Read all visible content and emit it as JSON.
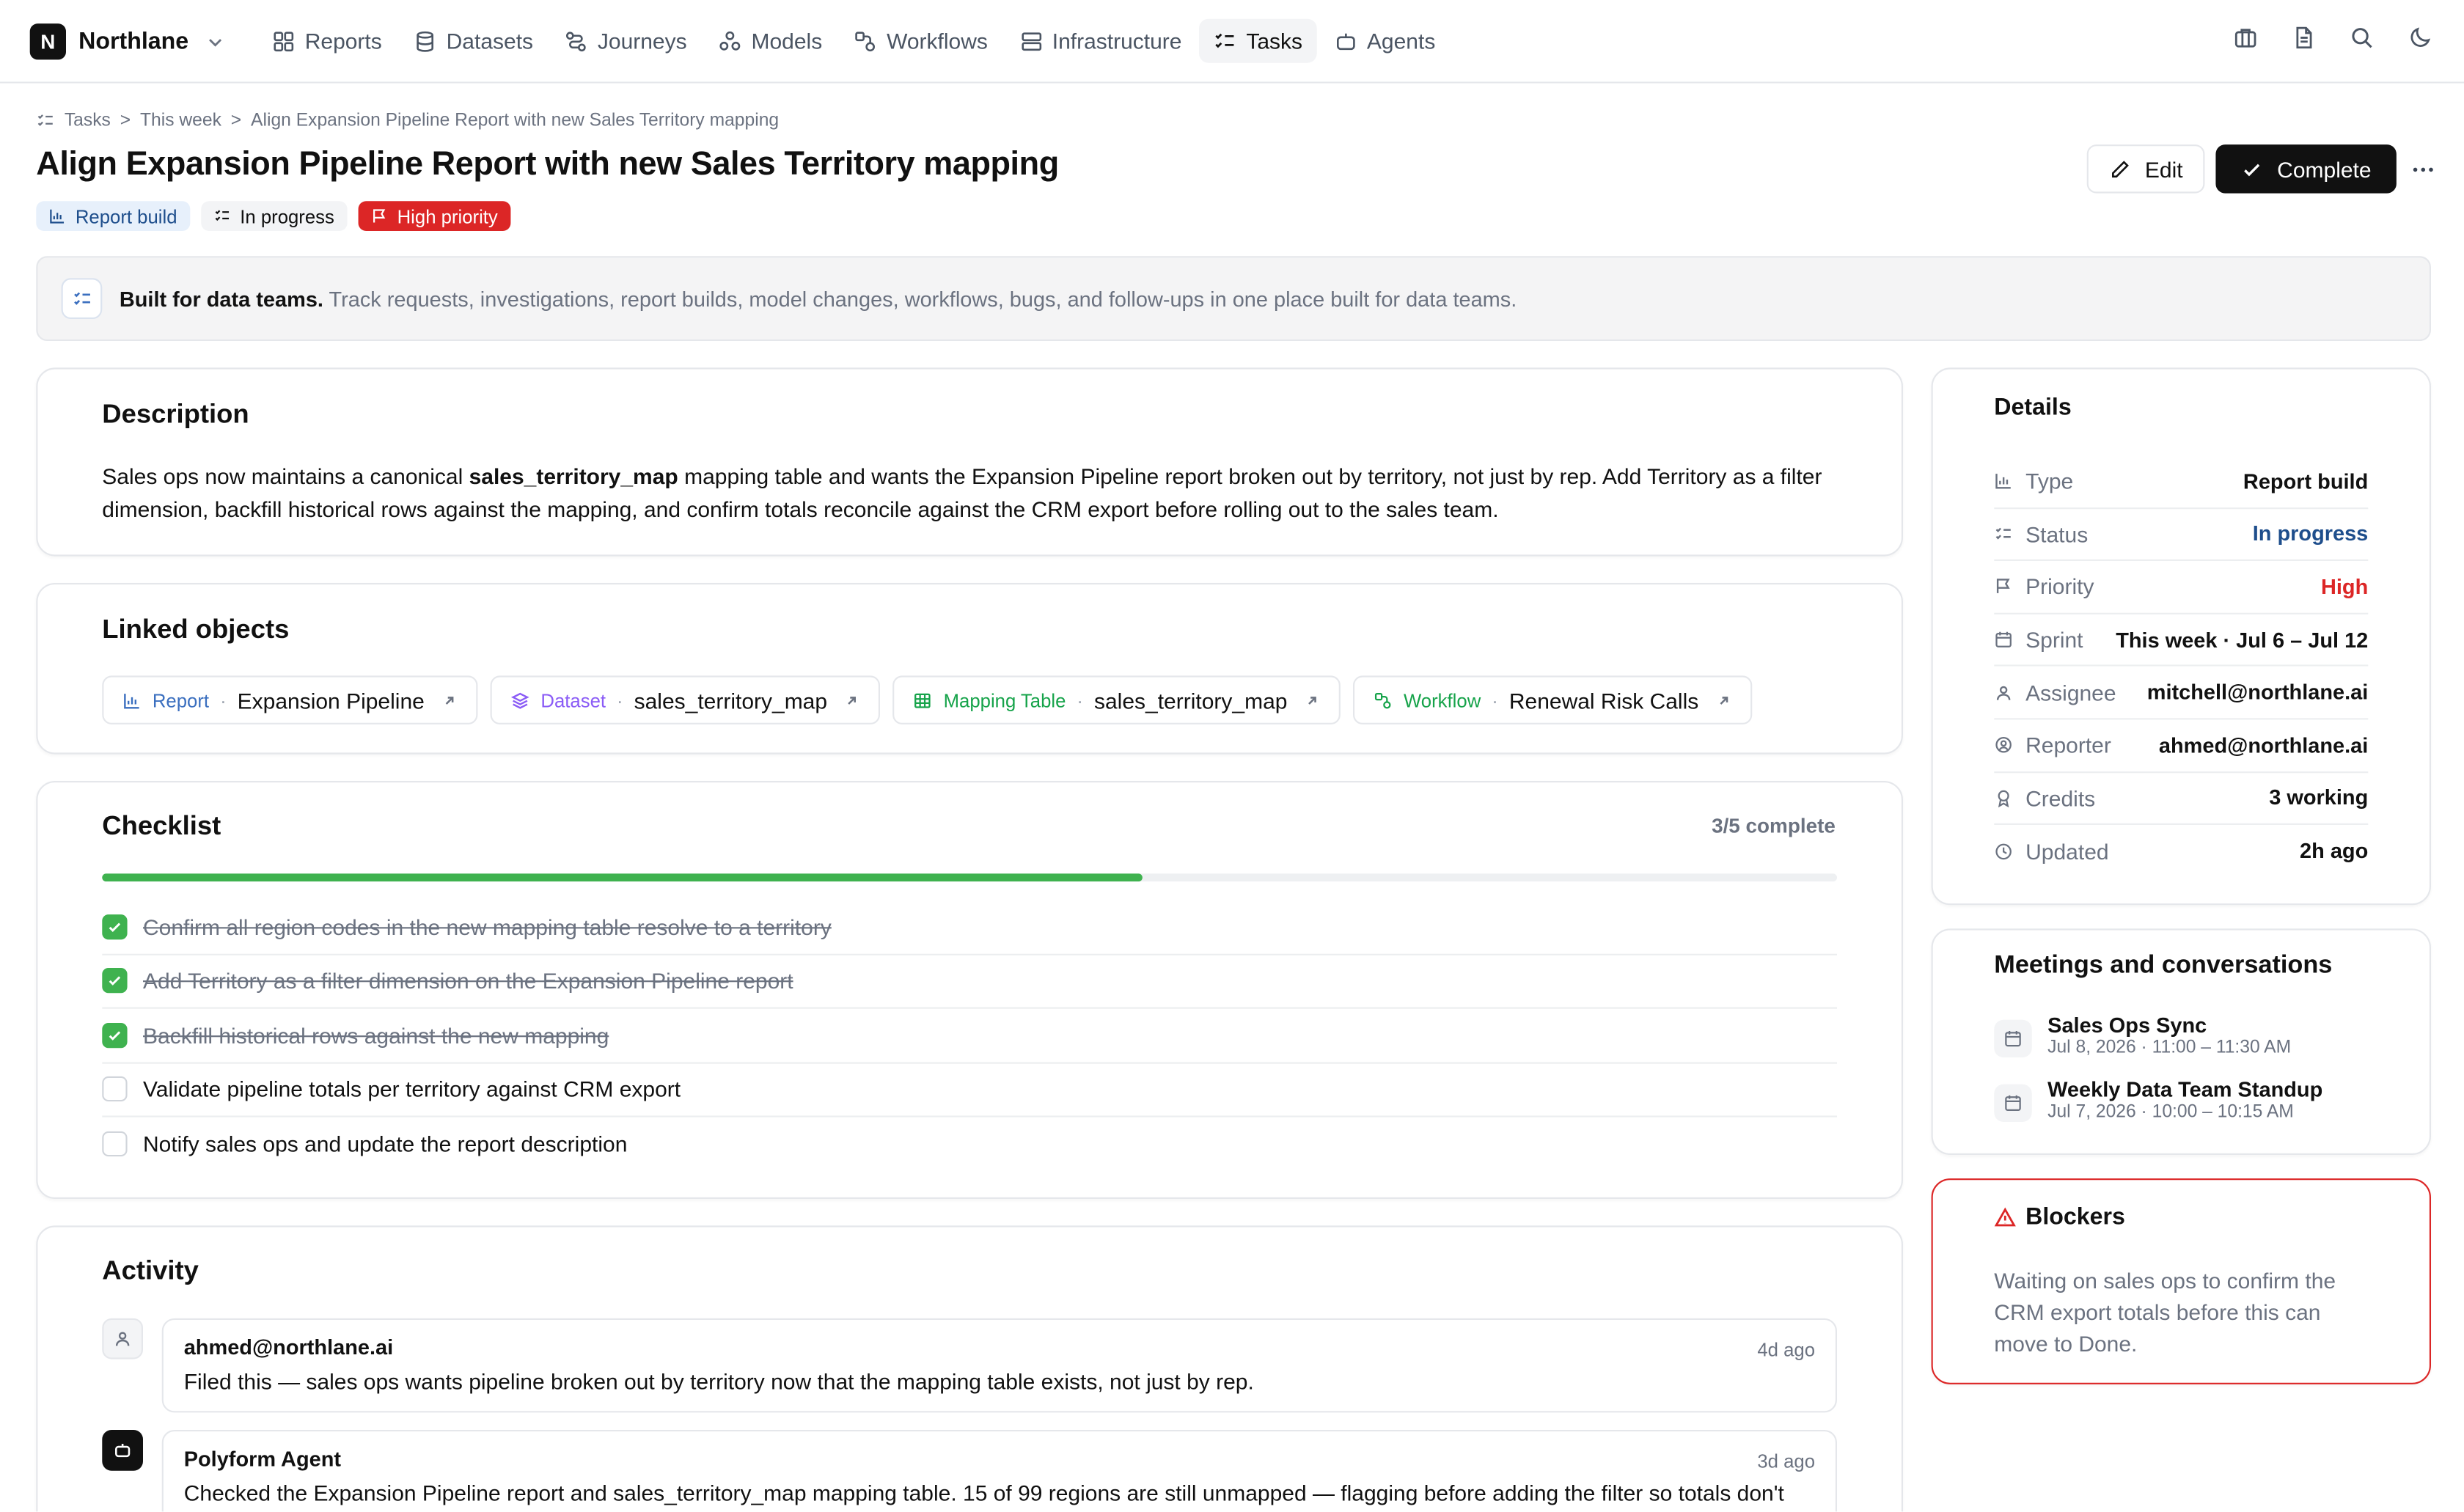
{
  "app": {
    "logo_letter": "N",
    "name": "Northlane"
  },
  "nav": [
    {
      "label": "Reports",
      "icon": "reports-icon"
    },
    {
      "label": "Datasets",
      "icon": "datasets-icon"
    },
    {
      "label": "Journeys",
      "icon": "journeys-icon"
    },
    {
      "label": "Models",
      "icon": "models-icon"
    },
    {
      "label": "Workflows",
      "icon": "workflows-icon"
    },
    {
      "label": "Infrastructure",
      "icon": "infrastructure-icon"
    },
    {
      "label": "Tasks",
      "icon": "tasks-icon",
      "active": true
    },
    {
      "label": "Agents",
      "icon": "agents-icon"
    }
  ],
  "top_icons": [
    "briefcase-icon",
    "document-icon",
    "search-icon",
    "moon-icon"
  ],
  "breadcrumb": {
    "root": "Tasks",
    "sep": ">",
    "mid": "This week",
    "leaf": "Align Expansion Pipeline Report with new Sales Territory mapping"
  },
  "title": "Align Expansion Pipeline Report with new Sales Territory mapping",
  "badges": {
    "type": "Report build",
    "status": "In progress",
    "priority": "High priority"
  },
  "actions": {
    "edit": "Edit",
    "complete": "Complete"
  },
  "banner": {
    "bold": "Built for data teams.",
    "text": "Track requests, investigations, report builds, model changes, workflows, bugs, and follow-ups in one place built for data teams."
  },
  "description": {
    "title": "Description",
    "before": "Sales ops now maintains a canonical ",
    "bold": "sales_territory_map",
    "after": " mapping table and wants the Expansion Pipeline report broken out by territory, not just by rep. Add Territory as a filter dimension, backfill historical rows against the mapping, and confirm totals reconcile against the CRM export before rolling out to the sales team."
  },
  "linked": {
    "title": "Linked objects",
    "items": [
      {
        "kind": "Report",
        "sep": "·",
        "name": "Expansion Pipeline",
        "color": "#3b6fbf"
      },
      {
        "kind": "Dataset",
        "sep": "·",
        "name": "sales_territory_map",
        "color": "#8b5cf6"
      },
      {
        "kind": "Mapping Table",
        "sep": "·",
        "name": "sales_territory_map",
        "color": "#16a34a"
      },
      {
        "kind": "Workflow",
        "sep": "·",
        "name": "Renewal Risk Calls",
        "color": "#16a34a"
      }
    ]
  },
  "checklist": {
    "title": "Checklist",
    "progress_label": "3/5 complete",
    "progress_fraction": 0.6,
    "items": [
      {
        "text": "Confirm all region codes in the new mapping table resolve to a territory",
        "done": true
      },
      {
        "text": "Add Territory as a filter dimension on the Expansion Pipeline report",
        "done": true
      },
      {
        "text": "Backfill historical rows against the new mapping",
        "done": true
      },
      {
        "text": "Validate pipeline totals per territory against CRM export",
        "done": false
      },
      {
        "text": "Notify sales ops and update the report description",
        "done": false
      }
    ]
  },
  "activity": {
    "title": "Activity",
    "entries": [
      {
        "author": "ahmed@northlane.ai",
        "time": "4d ago",
        "text": "Filed this — sales ops wants pipeline broken out by territory now that the mapping table exists, not just by rep."
      },
      {
        "author": "Polyform Agent",
        "time": "3d ago",
        "text": "Checked the Expansion Pipeline report and sales_territory_map mapping table. 15 of 99 regions are still unmapped — flagging before adding the filter so totals don't"
      }
    ]
  },
  "details": {
    "title": "Details",
    "rows": [
      {
        "label": "Type",
        "value": "Report build",
        "icon": "chart-icon"
      },
      {
        "label": "Status",
        "value": "In progress",
        "icon": "list-icon"
      },
      {
        "label": "Priority",
        "value": "High",
        "icon": "flag-icon"
      },
      {
        "label": "Sprint",
        "value": "This week · Jul 6 – Jul 12",
        "icon": "calendar-icon"
      },
      {
        "label": "Assignee",
        "value": "mitchell@northlane.ai",
        "icon": "user-icon"
      },
      {
        "label": "Reporter",
        "value": "ahmed@northlane.ai",
        "icon": "user-circle-icon"
      },
      {
        "label": "Credits",
        "value": "3 working",
        "icon": "award-icon"
      },
      {
        "label": "Updated",
        "value": "2h ago",
        "icon": "clock-icon"
      }
    ]
  },
  "meetings": {
    "title": "Meetings and conversations",
    "items": [
      {
        "name": "Sales Ops Sync",
        "time": "Jul 8, 2026 · 11:00 – 11:30 AM"
      },
      {
        "name": "Weekly Data Team Standup",
        "time": "Jul 7, 2026 · 10:00 – 10:15 AM"
      }
    ]
  },
  "blockers": {
    "title": "Blockers",
    "text": "Waiting on sales ops to confirm the CRM export totals before this can move to Done."
  }
}
